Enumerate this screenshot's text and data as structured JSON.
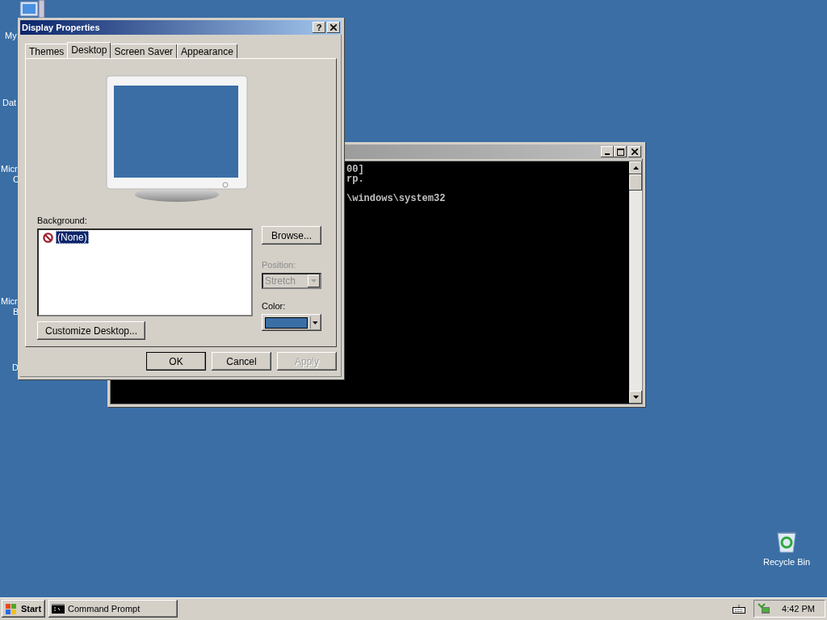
{
  "desktop_icons": [
    {
      "lines": [
        "My"
      ]
    },
    {
      "lines": [
        "Dat"
      ]
    },
    {
      "lines": [
        "Micr",
        "C"
      ]
    },
    {
      "lines": [
        "Micr",
        "B"
      ]
    },
    {
      "lines": [
        "D"
      ]
    }
  ],
  "console": {
    "paragraphs": [
      [
        "00]",
        "rp."
      ],
      [
        "\\windows\\system32"
      ]
    ]
  },
  "dialog": {
    "title": "Display Properties",
    "help_button": "?",
    "tabs": [
      {
        "label": "Themes",
        "selected": false
      },
      {
        "label": "Desktop",
        "selected": true
      },
      {
        "label": "Screen Saver",
        "selected": false
      },
      {
        "label": "Appearance",
        "selected": false
      }
    ],
    "background_label": "Background:",
    "backgrounds": [
      {
        "label": "(None)",
        "selected": true
      }
    ],
    "browse_button": "Browse...",
    "position_label": "Position:",
    "position": {
      "value": "Stretch",
      "disabled": true
    },
    "color_label": "Color:",
    "color": "#3a6ea5",
    "customize_button": "Customize Desktop...",
    "buttons": [
      {
        "label": "OK",
        "kind": "default",
        "disabled": false
      },
      {
        "label": "Cancel",
        "kind": "normal",
        "disabled": false
      },
      {
        "label": "Apply",
        "kind": "normal",
        "disabled": true
      }
    ]
  },
  "recycle_bin": {
    "label": "Recycle Bin"
  },
  "taskbar": {
    "start": "Start",
    "tasks": [
      {
        "label": "Command Prompt",
        "selected": false
      }
    ],
    "clock": "4:42 PM"
  }
}
